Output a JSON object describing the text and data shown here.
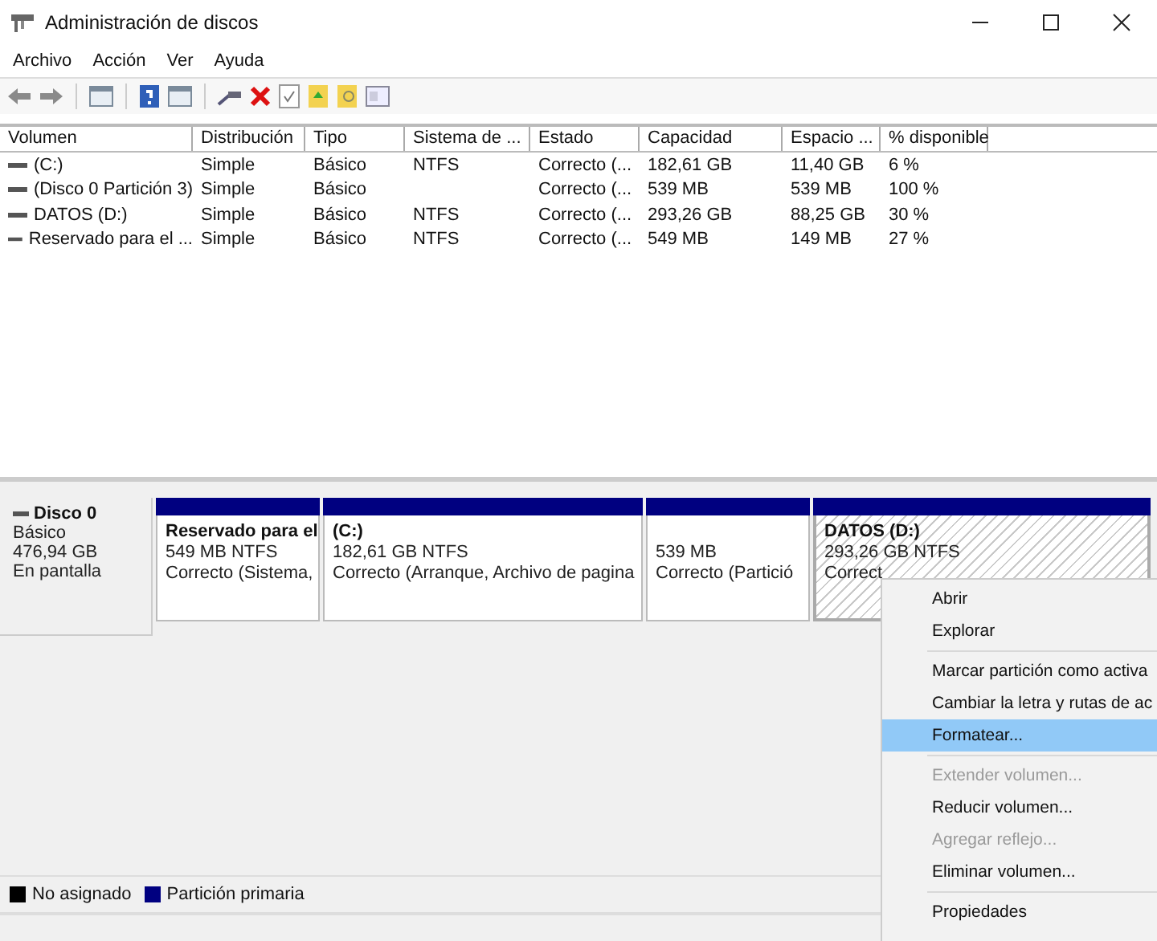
{
  "window": {
    "title": "Administración de discos"
  },
  "menu_bar": [
    "Archivo",
    "Acción",
    "Ver",
    "Ayuda"
  ],
  "table": {
    "columns": [
      "Volumen",
      "Distribución",
      "Tipo",
      "Sistema de ...",
      "Estado",
      "Capacidad",
      "Espacio ...",
      "% disponible"
    ],
    "rows": [
      {
        "cells": [
          "(C:)",
          "Simple",
          "Básico",
          "NTFS",
          "Correcto (...",
          "182,61 GB",
          "11,40 GB",
          "6 %"
        ]
      },
      {
        "cells": [
          "(Disco 0 Partición 3)",
          "Simple",
          "Básico",
          "",
          "Correcto (...",
          "539 MB",
          "539 MB",
          "100 %"
        ]
      },
      {
        "cells": [
          "DATOS (D:)",
          "Simple",
          "Básico",
          "NTFS",
          "Correcto (...",
          "293,26 GB",
          "88,25 GB",
          "30 %"
        ]
      },
      {
        "cells": [
          "Reservado para el ...",
          "Simple",
          "Básico",
          "NTFS",
          "Correcto (...",
          "549 MB",
          "149 MB",
          "27 %"
        ]
      }
    ]
  },
  "disk": {
    "name": "Disco 0",
    "type": "Básico",
    "size": "476,94 GB",
    "status": "En pantalla",
    "partitions": [
      {
        "name": "Reservado para el",
        "size": "549 MB NTFS",
        "status": "Correcto (Sistema,",
        "selected": false
      },
      {
        "name": "(C:)",
        "size": "182,61 GB NTFS",
        "status": "Correcto (Arranque, Archivo de pagina",
        "selected": false
      },
      {
        "size": "539 MB",
        "status": "Correcto (Partició",
        "selected": false
      },
      {
        "name": "DATOS  (D:)",
        "size": "293,26 GB NTFS",
        "status": "Correct",
        "selected": true
      }
    ]
  },
  "legend": [
    {
      "label": "No asignado",
      "color": "#000000"
    },
    {
      "label": "Partición primaria",
      "color": "#000080"
    }
  ],
  "context_menu": [
    {
      "kind": "item",
      "label": "Abrir",
      "disabled": false,
      "selected": false
    },
    {
      "kind": "item",
      "label": "Explorar",
      "disabled": false,
      "selected": false
    },
    {
      "kind": "separator"
    },
    {
      "kind": "item",
      "label": "Marcar partición como activa",
      "disabled": false,
      "selected": false
    },
    {
      "kind": "item",
      "label": "Cambiar la letra y rutas de ac",
      "disabled": false,
      "selected": false
    },
    {
      "kind": "item",
      "label": "Formatear...",
      "disabled": false,
      "selected": true
    },
    {
      "kind": "separator"
    },
    {
      "kind": "item",
      "label": "Extender volumen...",
      "disabled": true,
      "selected": false
    },
    {
      "kind": "item",
      "label": "Reducir volumen...",
      "disabled": false,
      "selected": false
    },
    {
      "kind": "item",
      "label": "Agregar reflejo...",
      "disabled": true,
      "selected": false
    },
    {
      "kind": "item",
      "label": "Eliminar volumen...",
      "disabled": false,
      "selected": false
    },
    {
      "kind": "separator"
    },
    {
      "kind": "item",
      "label": "Propiedades",
      "disabled": false,
      "selected": false
    }
  ]
}
